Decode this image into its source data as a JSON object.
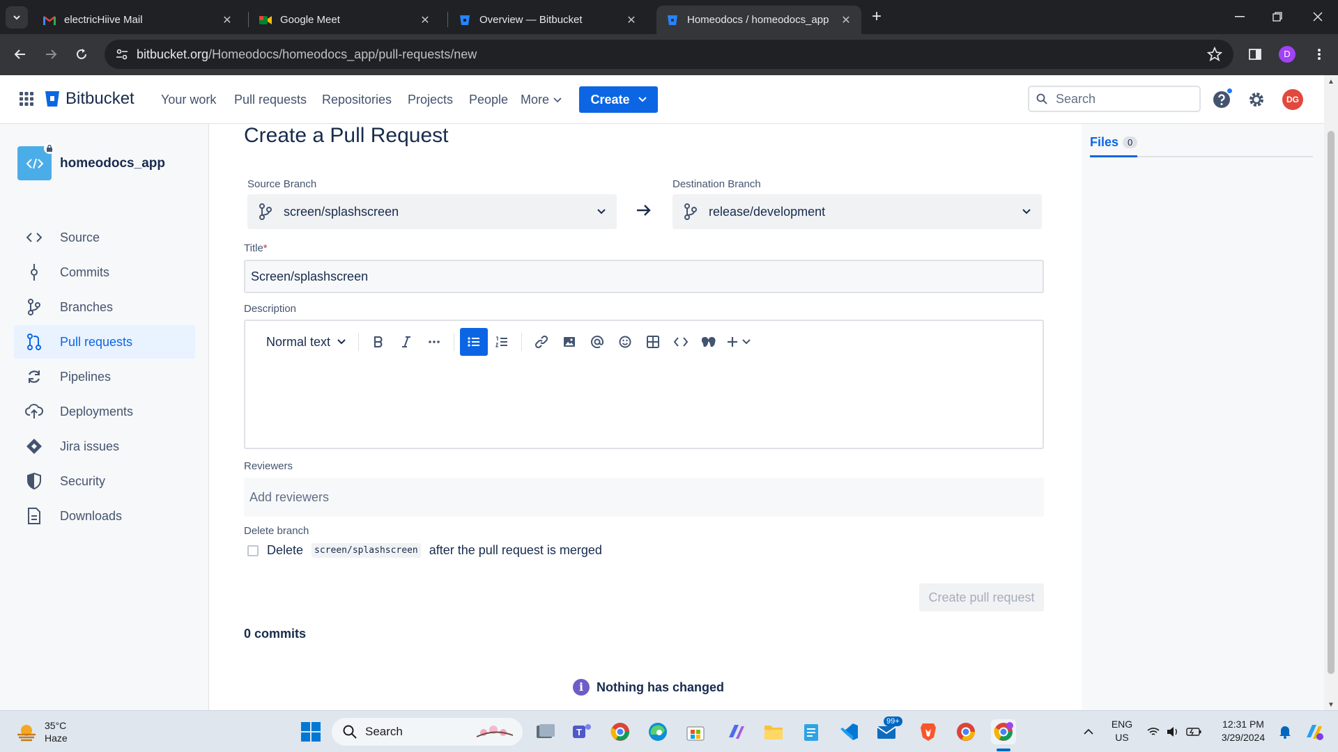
{
  "browser": {
    "tabs": [
      {
        "title": "electricHiive Mail",
        "icon": "gmail-icon"
      },
      {
        "title": "Google Meet",
        "icon": "google-meet-icon"
      },
      {
        "title": "Overview — Bitbucket",
        "icon": "bitbucket-icon"
      },
      {
        "title": "Homeodocs / homeodocs_app",
        "icon": "bitbucket-icon",
        "active": true
      }
    ],
    "url_host": "bitbucket.org",
    "url_path": "/Homeodocs/homeodocs_app/pull-requests/new",
    "profile_initial": "D"
  },
  "topnav": {
    "brand": "Bitbucket",
    "items": [
      "Your work",
      "Pull requests",
      "Repositories",
      "Projects",
      "People",
      "More"
    ],
    "create_label": "Create",
    "search_placeholder": "Search",
    "avatar_initials": "DG"
  },
  "sidebar": {
    "repo_name": "homeodocs_app",
    "items": [
      {
        "label": "Source",
        "icon": "code-icon"
      },
      {
        "label": "Commits",
        "icon": "commit-icon"
      },
      {
        "label": "Branches",
        "icon": "branch-icon"
      },
      {
        "label": "Pull requests",
        "icon": "pull-request-icon",
        "active": true
      },
      {
        "label": "Pipelines",
        "icon": "pipelines-icon"
      },
      {
        "label": "Deployments",
        "icon": "cloud-upload-icon"
      },
      {
        "label": "Jira issues",
        "icon": "jira-icon"
      },
      {
        "label": "Security",
        "icon": "shield-icon"
      },
      {
        "label": "Downloads",
        "icon": "download-file-icon"
      }
    ]
  },
  "form": {
    "page_title": "Create a Pull Request",
    "source_label": "Source Branch",
    "source_value": "screen/splashscreen",
    "destination_label": "Destination Branch",
    "destination_value": "release/development",
    "title_label": "Title",
    "title_required": "*",
    "title_value": "Screen/splashscreen",
    "description_label": "Description",
    "text_style": "Normal text",
    "reviewers_label": "Reviewers",
    "reviewers_placeholder": "Add reviewers",
    "delete_branch_label": "Delete branch",
    "delete_prefix": "Delete",
    "delete_branch_code": "screen/splashscreen",
    "delete_suffix": "after the pull request is merged",
    "create_button": "Create pull request",
    "commits_count": "0 commits",
    "nothing_changed": "Nothing has changed",
    "info_glyph": "i"
  },
  "rightpanel": {
    "files_label": "Files",
    "files_count": "0"
  },
  "taskbar": {
    "temperature": "35°C",
    "condition": "Haze",
    "search_label": "Search",
    "badge": "99+",
    "lang": "ENG",
    "region": "US",
    "time": "12:31 PM",
    "date": "3/29/2024"
  },
  "colors": {
    "accent": "#0c66e4",
    "sidebar_active_bg": "#e9f2ff",
    "avatar": "#e2483d"
  }
}
